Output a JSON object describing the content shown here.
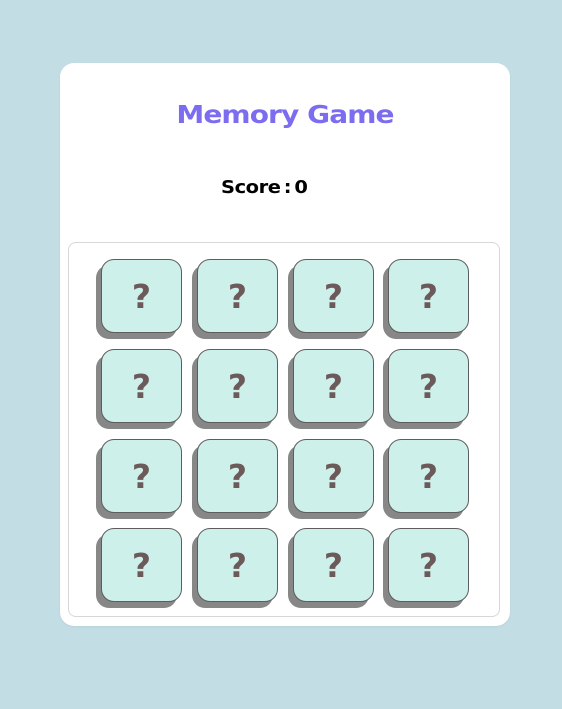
{
  "game": {
    "title": "Memory Game",
    "score_label": "Score",
    "score_separator": ":",
    "score_value": "0"
  },
  "colors": {
    "page_background": "#c3dde5",
    "title": "#7b6cf0",
    "tile_face": "#cdf0ea",
    "tile_shadow": "#878787",
    "tile_symbol": "#6c5a5a"
  },
  "board": {
    "rows": 4,
    "cols": 4,
    "tiles": [
      "?",
      "?",
      "?",
      "?",
      "?",
      "?",
      "?",
      "?",
      "?",
      "?",
      "?",
      "?",
      "?",
      "?",
      "?",
      "?"
    ]
  }
}
